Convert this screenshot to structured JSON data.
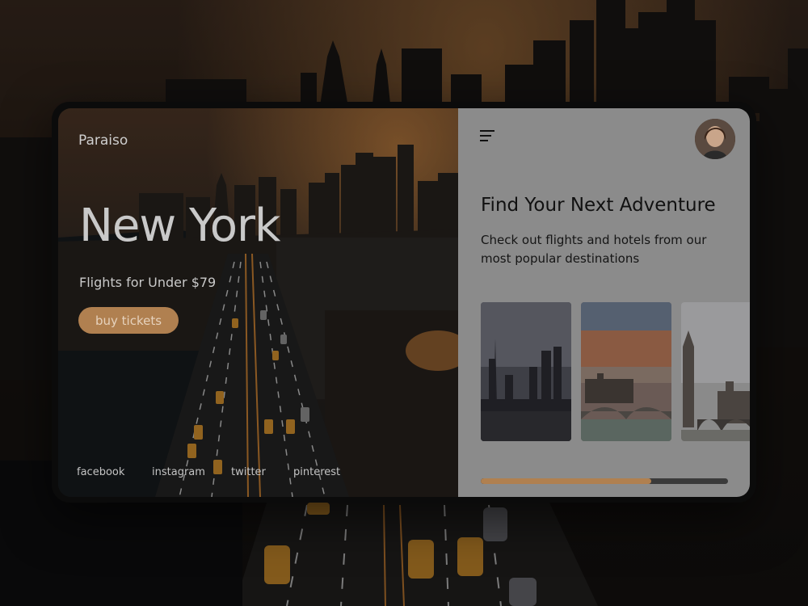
{
  "brand": "Paraiso",
  "hero": {
    "city": "New York",
    "tagline": "Flights for Under $79",
    "cta_label": "buy tickets"
  },
  "social": [
    "facebook",
    "instagram",
    "twitter",
    "pinterest"
  ],
  "panel": {
    "title": "Find Your Next Adventure",
    "subtitle": "Check out flights and hotels from our most popular destinations",
    "menu_icon": "hamburger-menu-icon",
    "avatar": "user-avatar",
    "progress": 0.69
  },
  "destinations": [
    {
      "name": "shanghai-skyline",
      "tint": "#4a4a50"
    },
    {
      "name": "sunset-bridge",
      "tint": "#8a5a40"
    },
    {
      "name": "london-big-ben",
      "tint": "#7a7a7a"
    }
  ],
  "colors": {
    "accent": "#b08050",
    "panel_bg": "#8b8b8b",
    "card_bg": "#0b0b0b"
  }
}
